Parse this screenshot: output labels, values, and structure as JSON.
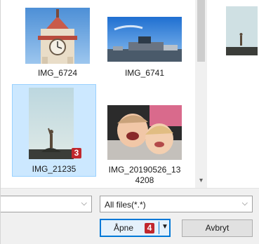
{
  "files": [
    {
      "name": "IMG_6724",
      "selected": false
    },
    {
      "name": "IMG_6741",
      "selected": false
    },
    {
      "name": "IMG_21235",
      "selected": true
    },
    {
      "name_line1": "IMG_20190526_13",
      "name_line2": "4208",
      "selected": false
    }
  ],
  "badges": {
    "file_step": "3",
    "open_step": "4"
  },
  "bottom": {
    "filename_value": "",
    "filetype_value": "All files(*.*)",
    "open_label": "Åpne",
    "cancel_label": "Avbryt"
  },
  "colors": {
    "selection_bg": "#cce8ff",
    "selection_border": "#99d1ff",
    "primary_border": "#0078d7",
    "badge_red": "#c1272d"
  }
}
